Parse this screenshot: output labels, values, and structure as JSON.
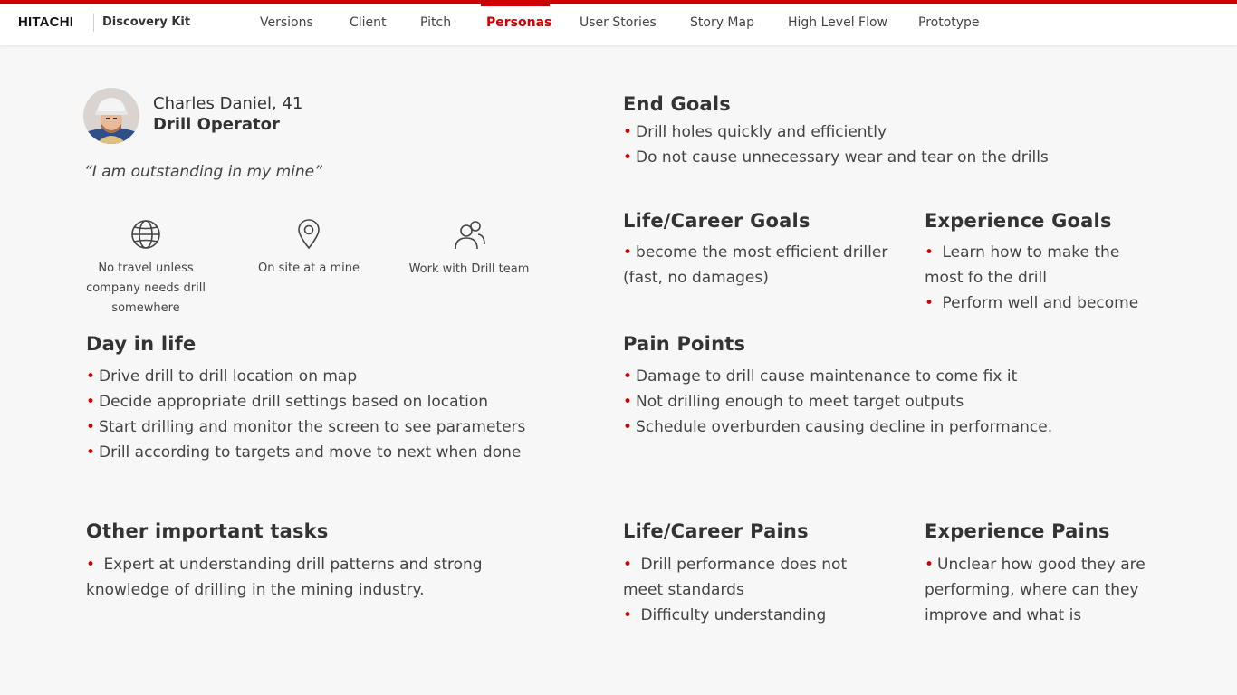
{
  "header": {
    "logo": "HITACHI",
    "kit": "Discovery Kit",
    "nav": [
      "Versions",
      "Client",
      "Pitch",
      "Personas",
      "User Stories",
      "Story Map",
      "High Level Flow",
      "Prototype"
    ],
    "active": "Personas",
    "accent_color": "#cc0000"
  },
  "persona": {
    "name": "Charles Daniel, 41",
    "role": "Drill Operator",
    "quote": "“I am outstanding in my mine”",
    "features": [
      {
        "icon": "globe-icon",
        "text": "No travel unless company needs drill somewhere"
      },
      {
        "icon": "location-pin-icon",
        "text": "On site at a mine"
      },
      {
        "icon": "users-icon",
        "text": "Work with Drill team"
      }
    ]
  },
  "sections": {
    "day_in_life": {
      "title": "Day in life",
      "items": [
        "Drive drill to drill location on map",
        "Decide appropriate drill settings based on location",
        "Start drilling and monitor the screen to see parameters",
        "Drill according to targets and move to next when done"
      ]
    },
    "other_tasks": {
      "title": "Other important tasks",
      "items": [
        "Expert at understanding drill patterns and strong knowledge of drilling in the mining industry."
      ]
    },
    "end_goals": {
      "title": "End Goals",
      "items": [
        "Drill holes quickly and efficiently",
        "Do not cause unnecessary wear and tear on the drills"
      ]
    },
    "life_career_goals": {
      "title": "Life/Career Goals",
      "items": [
        "become the most efficient driller (fast, no damages)"
      ]
    },
    "experience_goals": {
      "title": "Experience Goals",
      "items": [
        "Learn how to make the most fo the drill",
        "Perform well and become"
      ]
    },
    "pain_points": {
      "title": "Pain Points",
      "items": [
        "Damage to drill cause maintenance to come fix it",
        "Not drilling enough to meet target outputs",
        "Schedule overburden causing decline in performance."
      ]
    },
    "life_career_pains": {
      "title": "Life/Career Pains",
      "items": [
        "Drill performance does not meet standards",
        "Difficulty understanding"
      ]
    },
    "experience_pains": {
      "title": "Experience Pains",
      "items": [
        "Unclear how good they are performing, where can they improve and what is"
      ]
    }
  }
}
